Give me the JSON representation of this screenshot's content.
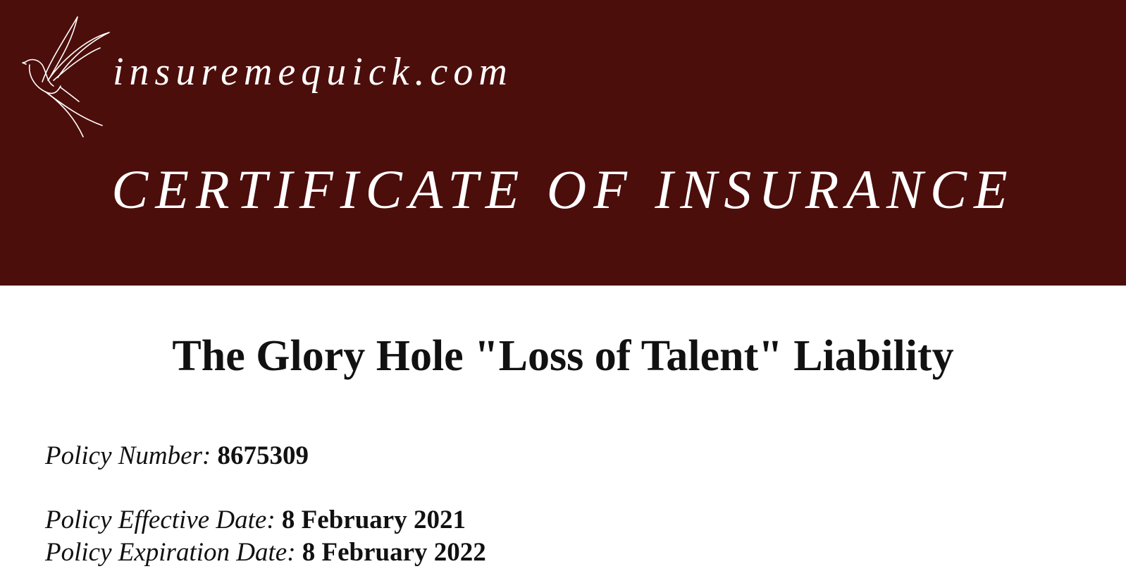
{
  "header": {
    "site_name": "insuremequick.com",
    "certificate_title": "CERTIFICATE OF INSURANCE",
    "logo_icon": "bird-icon",
    "background_color": "#4c0e0b"
  },
  "policy": {
    "title": "The Glory Hole \"Loss of Talent\" Liability",
    "number_label": "Policy Number:",
    "number_value": "8675309",
    "effective_label": "Policy Effective Date:",
    "effective_value": "8 February 2021",
    "expiration_label": "Policy Expiration Date:",
    "expiration_value": "8 February 2022"
  }
}
